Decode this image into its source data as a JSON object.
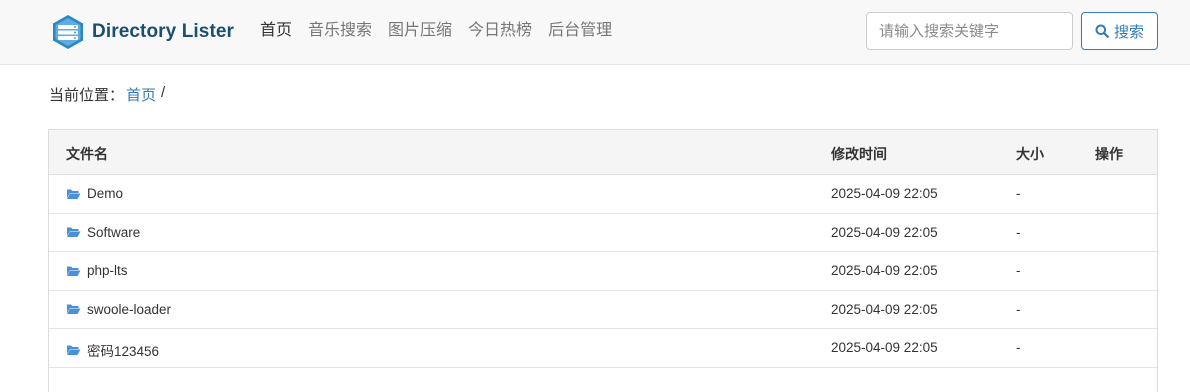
{
  "brand": {
    "name": "Directory Lister"
  },
  "nav": [
    {
      "label": "首页"
    },
    {
      "label": "音乐搜索"
    },
    {
      "label": "图片压缩"
    },
    {
      "label": "今日热榜"
    },
    {
      "label": "后台管理"
    }
  ],
  "search": {
    "placeholder": "请输入搜索关键字",
    "button_label": "搜索"
  },
  "breadcrumb": {
    "prefix": "当前位置：",
    "home": "首页",
    "separator": "/"
  },
  "table": {
    "headers": {
      "name": "文件名",
      "modified": "修改时间",
      "size": "大小",
      "actions": "操作"
    },
    "rows": [
      {
        "name": "Demo",
        "modified": "2025-04-09 22:05",
        "size": "-"
      },
      {
        "name": "Software",
        "modified": "2025-04-09 22:05",
        "size": "-"
      },
      {
        "name": "php-lts",
        "modified": "2025-04-09 22:05",
        "size": "-"
      },
      {
        "name": "swoole-loader",
        "modified": "2025-04-09 22:05",
        "size": "-"
      },
      {
        "name": "密码123456",
        "modified": "2025-04-09 22:05",
        "size": "-"
      }
    ]
  },
  "colors": {
    "brand_text": "#1b4f72",
    "link": "#337ab7",
    "folder_icon": "#4a90d9"
  },
  "icons": {
    "logo": "server-stack-icon",
    "search": "search-icon",
    "folder": "folder-open-icon"
  }
}
